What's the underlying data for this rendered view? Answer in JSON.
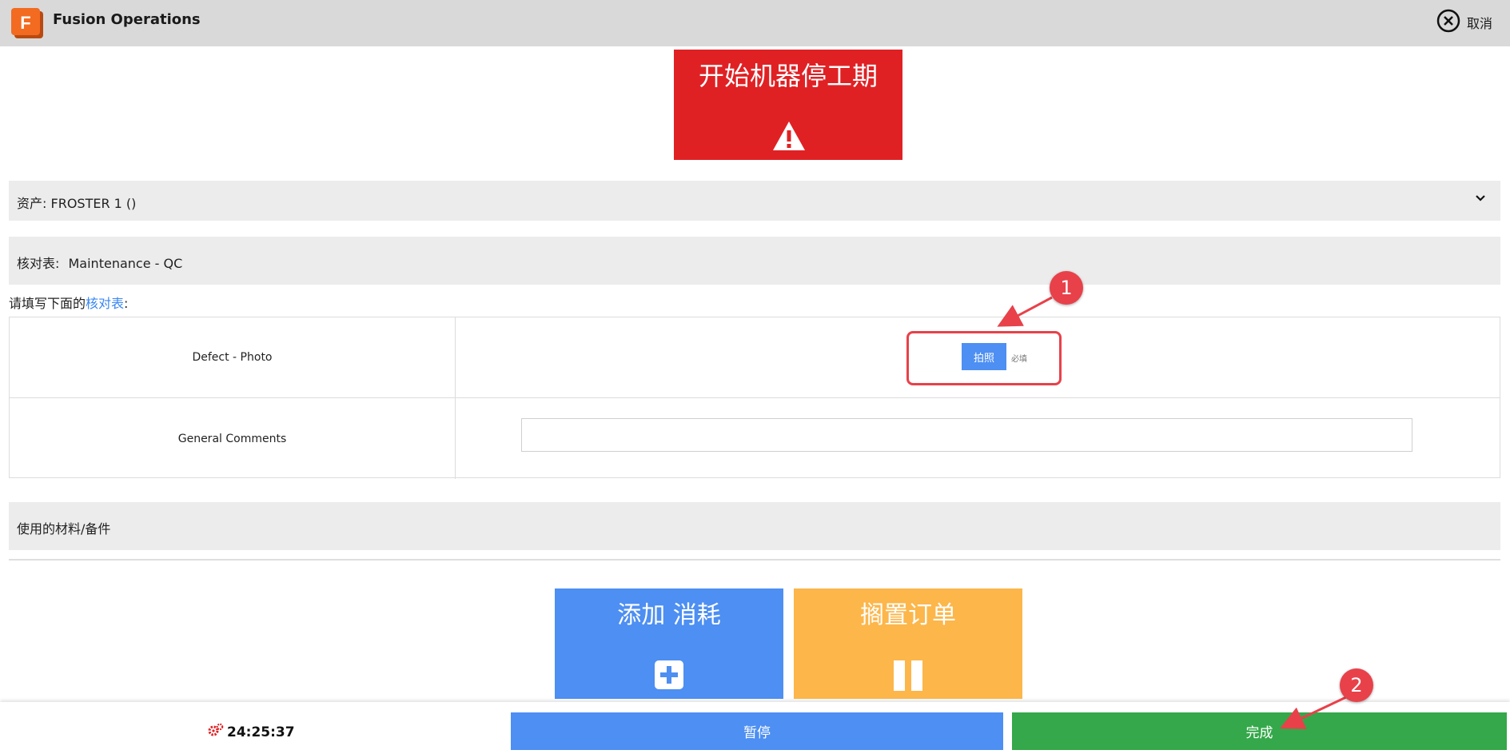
{
  "app": {
    "title": "Fusion Operations",
    "logo_letter": "F",
    "cancel_label": "取消"
  },
  "downtime": {
    "label": "开始机器停工期",
    "icon": "warning-icon"
  },
  "asset": {
    "label": "资产:",
    "value": "FROSTER 1 ()"
  },
  "checklist": {
    "label": "核对表:",
    "value": "Maintenance - QC"
  },
  "instruction": {
    "prefix": "请填写下面的",
    "link": "核对表",
    "suffix": ":"
  },
  "form": {
    "rows": [
      {
        "label": "Defect - Photo",
        "button_label": "拍照",
        "required_label": "必填"
      },
      {
        "label": "General Comments",
        "input_value": ""
      }
    ]
  },
  "materials": {
    "label": "使用的材料/备件"
  },
  "actions": {
    "add_consumption_label": "添加 消耗",
    "hold_order_label": "搁置订单"
  },
  "footer": {
    "timer": "24:25:37",
    "pause_label": "暂停",
    "complete_label": "完成"
  },
  "annotations": {
    "marker1": "1",
    "marker2": "2"
  },
  "colors": {
    "header_bg": "#d9d9d9",
    "downtime_red": "#e02124",
    "primary_blue": "#4d8ff2",
    "hold_orange": "#fcb64a",
    "complete_green": "#34a84a",
    "annotation_red": "#e8414a",
    "link_blue": "#3a87f2"
  }
}
